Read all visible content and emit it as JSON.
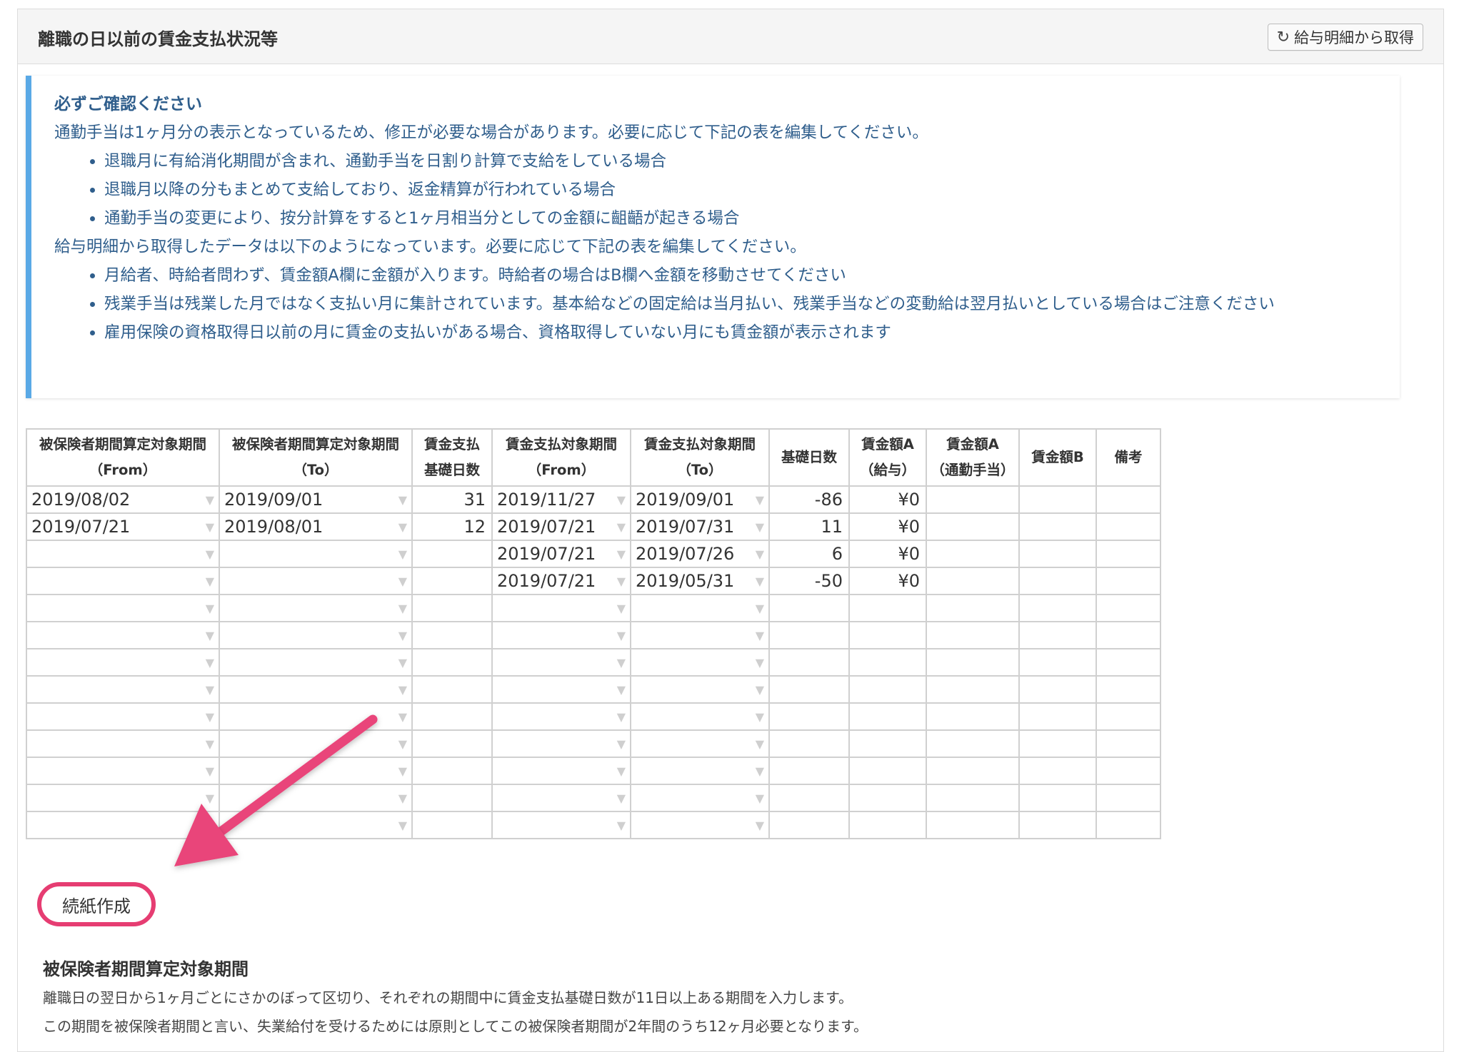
{
  "panel": {
    "title": "離職の日以前の賃金支払状況等",
    "fetch_button": "給与明細から取得"
  },
  "notice": {
    "title": "必ずご確認ください",
    "para1": "通勤手当は1ヶ月分の表示となっているため、修正が必要な場合があります。必要に応じて下記の表を編集してください。",
    "list1": [
      "退職月に有給消化期間が含まれ、通勤手当を日割り計算で支給をしている場合",
      "退職月以降の分もまとめて支給しており、返金精算が行われている場合",
      "通勤手当の変更により、按分計算をすると1ヶ月相当分としての金額に齟齬が起きる場合"
    ],
    "para2": "給与明細から取得したデータは以下のようになっています。必要に応じて下記の表を編集してください。",
    "list2": [
      "月給者、時給者問わず、賃金額A欄に金額が入ります。時給者の場合はB欄へ金額を移動させてください",
      "残業手当は残業した月ではなく支払い月に集計されています。基本給などの固定給は当月払い、残業手当などの変動給は翌月払いとしている場合はご注意ください",
      "雇用保険の資格取得日以前の月に賃金の支払いがある場合、資格取得していない月にも賃金額が表示されます"
    ]
  },
  "table": {
    "headers": [
      {
        "l1": "被保険者期間算定対象期間",
        "l2": "（From）"
      },
      {
        "l1": "被保険者期間算定対象期間",
        "l2": "（To）"
      },
      {
        "l1": "賃金支払",
        "l2": "基礎日数"
      },
      {
        "l1": "賃金支払対象期間",
        "l2": "（From）"
      },
      {
        "l1": "賃金支払対象期間",
        "l2": "（To）"
      },
      {
        "l1": "基礎日数",
        "l2": ""
      },
      {
        "l1": "賃金額A",
        "l2": "（給与）"
      },
      {
        "l1": "賃金額A",
        "l2": "（通勤手当）"
      },
      {
        "l1": "賃金額B",
        "l2": ""
      },
      {
        "l1": "備考",
        "l2": ""
      }
    ],
    "rows": [
      [
        "2019/08/02",
        "2019/09/01",
        "31",
        "2019/11/27",
        "2019/09/01",
        "-86",
        "¥0",
        "",
        "",
        ""
      ],
      [
        "2019/07/21",
        "2019/08/01",
        "12",
        "2019/07/21",
        "2019/07/31",
        "11",
        "¥0",
        "",
        "",
        ""
      ],
      [
        "",
        "",
        "",
        "2019/07/21",
        "2019/07/26",
        "6",
        "¥0",
        "",
        "",
        ""
      ],
      [
        "",
        "",
        "",
        "2019/07/21",
        "2019/05/31",
        "-50",
        "¥0",
        "",
        "",
        ""
      ],
      [
        "",
        "",
        "",
        "",
        "",
        "",
        "",
        "",
        "",
        ""
      ],
      [
        "",
        "",
        "",
        "",
        "",
        "",
        "",
        "",
        "",
        ""
      ],
      [
        "",
        "",
        "",
        "",
        "",
        "",
        "",
        "",
        "",
        ""
      ],
      [
        "",
        "",
        "",
        "",
        "",
        "",
        "",
        "",
        "",
        ""
      ],
      [
        "",
        "",
        "",
        "",
        "",
        "",
        "",
        "",
        "",
        ""
      ],
      [
        "",
        "",
        "",
        "",
        "",
        "",
        "",
        "",
        "",
        ""
      ],
      [
        "",
        "",
        "",
        "",
        "",
        "",
        "",
        "",
        "",
        ""
      ],
      [
        "",
        "",
        "",
        "",
        "",
        "",
        "",
        "",
        "",
        ""
      ],
      [
        "",
        "",
        "",
        "",
        "",
        "",
        "",
        "",
        "",
        ""
      ]
    ],
    "dropdown_marker": "▼"
  },
  "continuation_button": "続紙作成",
  "section": {
    "title": "被保険者期間算定対象期間",
    "line1": "離職日の翌日から1ヶ月ごとにさかのぼって区切り、それぞれの期間中に賃金支払基礎日数が11日以上ある期間を入力します。",
    "line2": "この期間を被保険者期間と言い、失業給付を受けるためには原則としてこの被保険者期間が2年間のうち12ヶ月必要となります。"
  },
  "colors": {
    "notice_border": "#5aa9e6",
    "notice_text": "#2f5e8c",
    "highlight": "#e63d72"
  },
  "icons": {
    "fetch_button": "refresh-icon",
    "dropdown": "triangle-down-icon"
  }
}
